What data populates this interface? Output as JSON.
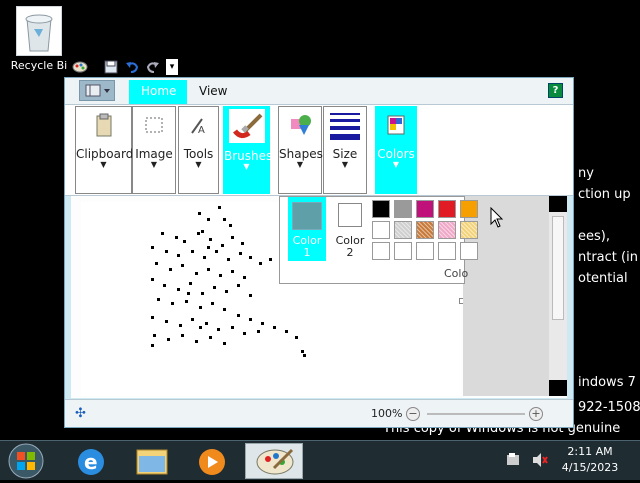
{
  "desktop": {
    "recycle_bin_label": "Recycle Bi",
    "background_lines": [
      "ny",
      "ction up",
      "ees),",
      "ntract (in",
      "otential",
      "indows 7",
      "922-1508",
      "This copy of Windows is not genuine"
    ]
  },
  "window": {
    "tabs": {
      "home": "Home",
      "view": "View"
    },
    "help_label": "?",
    "ribbon": {
      "clipboard": "Clipboard",
      "image": "Image",
      "tools": "Tools",
      "brushes": "Brushes",
      "shapes": "Shapes",
      "size": "Size",
      "colors": "Colors"
    },
    "colors_dropdown": {
      "color1_label": "Color",
      "color1_num": "1",
      "color2_label": "Color",
      "color2_num": "2",
      "group_label": "Colo",
      "color1_value": "#5fa0a8",
      "color2_value": "#ffffff",
      "palette_row1": [
        "#000000",
        "#9a9a9a",
        "#c0107a",
        "#e01b24",
        "#f5a000"
      ],
      "palette_row3": [
        "#ffffff",
        "#ffffff",
        "#ffffff",
        "#ffffff",
        "#ffffff"
      ]
    },
    "status": {
      "zoom": "100%"
    }
  },
  "taskbar": {
    "time": "2:11 AM",
    "date": "4/15/2023"
  },
  "accent": "#00ffff"
}
